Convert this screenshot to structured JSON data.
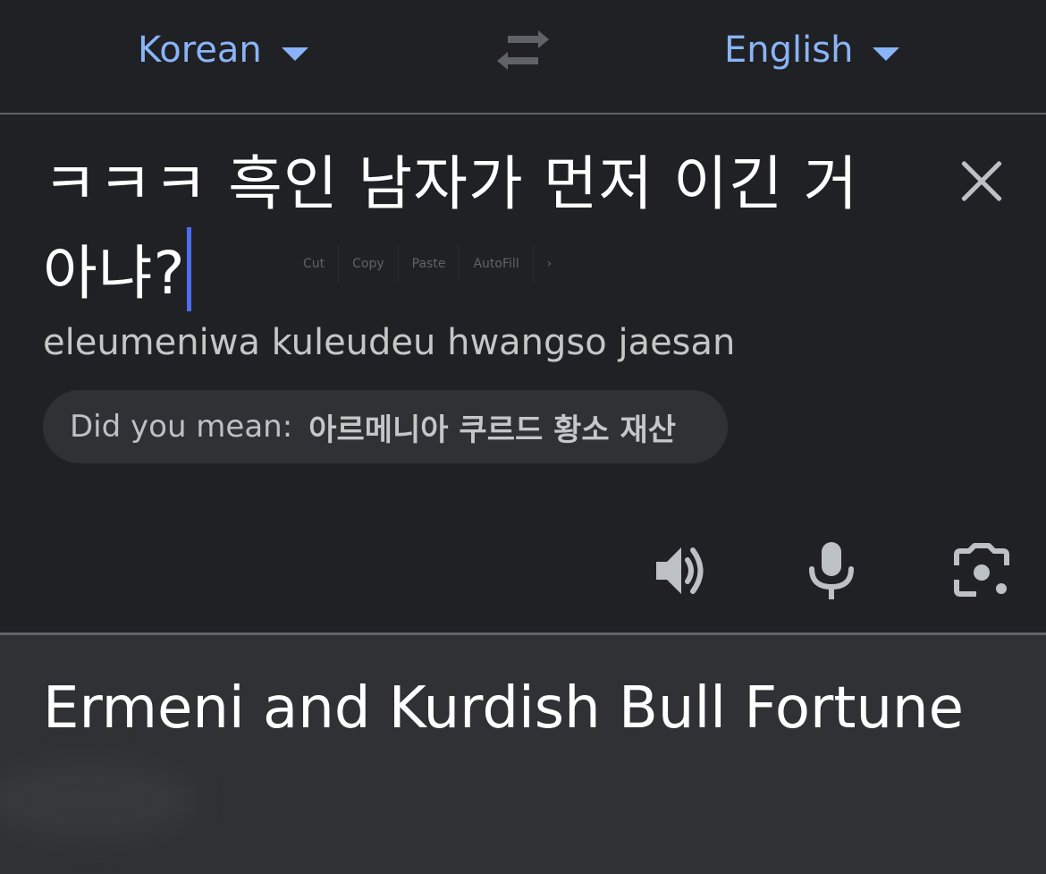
{
  "languages": {
    "source": "Korean",
    "target": "English"
  },
  "icons": {
    "dropdown": "caret-down-icon",
    "swap": "swap-arrows-icon",
    "clear": "close-icon",
    "listen": "speaker-icon",
    "voice": "microphone-icon",
    "camera": "camera-lens-icon"
  },
  "input": {
    "line1": "ㅋㅋㅋ 흑인 남자가 먼저 이긴 거",
    "line2": "아냐?",
    "romanization": "eleumeniwa kuleudeu hwangso jaesan"
  },
  "edit_menu": {
    "cut": "Cut",
    "copy": "Copy",
    "paste": "Paste",
    "autofill": "AutoFill",
    "more": "›"
  },
  "did_you_mean": {
    "label": "Did you mean:",
    "suggestion": "아르메니아 쿠르드 황소 재산"
  },
  "output": {
    "translation": "Ermeni and Kurdish Bull Fortune"
  },
  "colors": {
    "background": "#202124",
    "output_background": "#303134",
    "accent": "#8ab4f8",
    "cursor": "#4c6ef5"
  }
}
